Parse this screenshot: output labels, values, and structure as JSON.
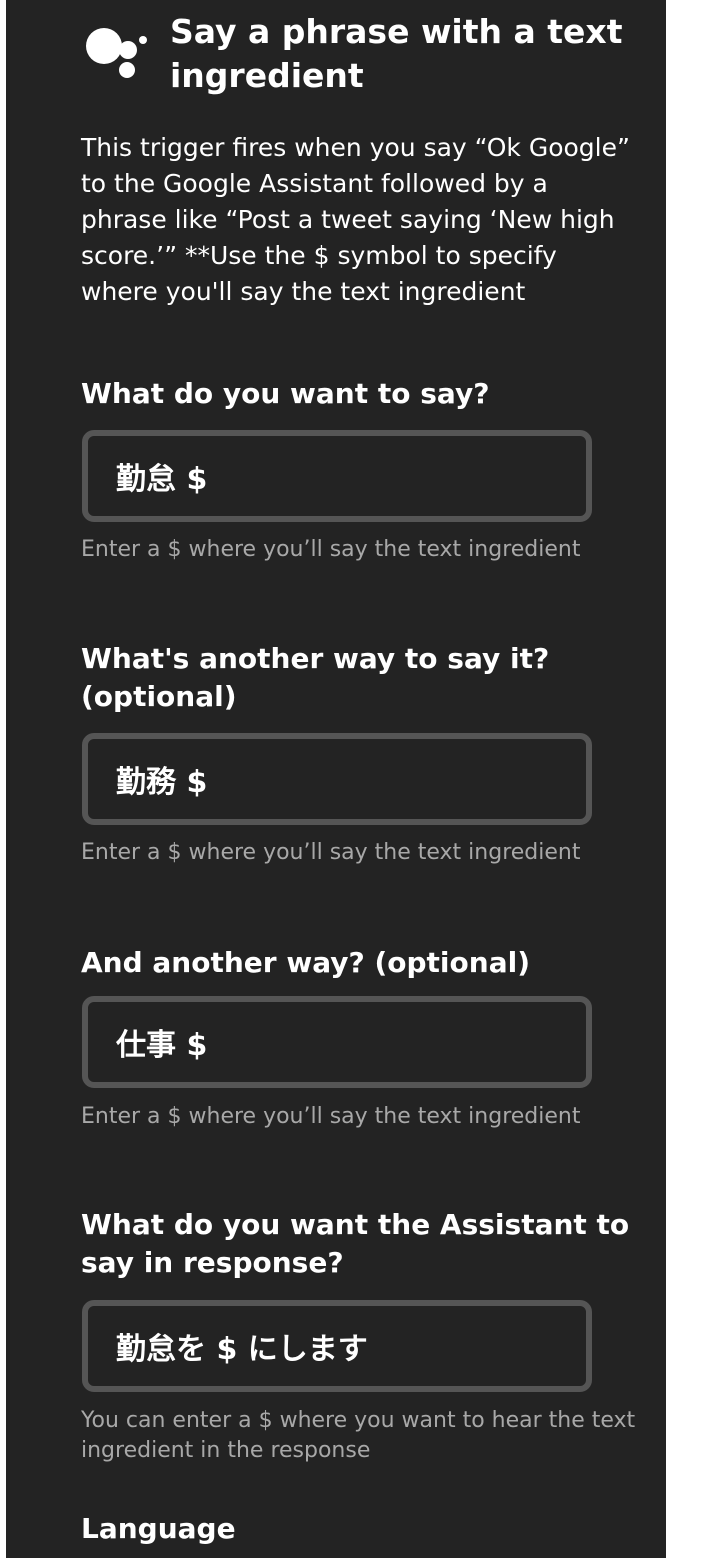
{
  "header": {
    "title": "Say a phrase with a text ingredient",
    "icon": "google-assistant-icon"
  },
  "description": "This trigger fires when you say “Ok Google” to the Google Assistant followed by a phrase like “Post a tweet saying ‘New high score.’” **Use the $ symbol to specify where you'll say the text ingredient",
  "fields": [
    {
      "label": "What do you want to say?",
      "value": "勤怠 $",
      "help": "Enter a $ where you’ll say the text ingredient"
    },
    {
      "label": "What's another way to say it? (optional)",
      "value": "勤務 $",
      "help": "Enter a $ where you’ll say the text ingredient"
    },
    {
      "label": "And another way? (optional)",
      "value": "仕事 $",
      "help": "Enter a $ where you’ll say the text ingredient"
    },
    {
      "label": "What do you want the Assistant to say in response?",
      "value": "勤怠を $ にします",
      "help": "You can enter a $ where you want to hear the text ingredient in the response"
    }
  ],
  "language": {
    "label": "Language"
  },
  "colors": {
    "panel_background": "#232323",
    "input_border": "#555555",
    "help_text": "#a8a8a8",
    "text": "#ffffff"
  }
}
